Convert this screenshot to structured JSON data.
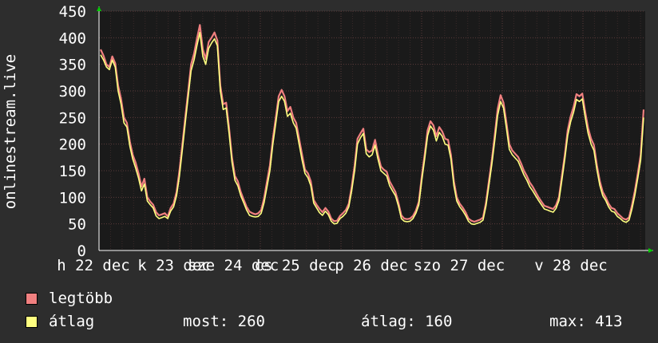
{
  "chart_data": {
    "type": "line",
    "ylabel": "onlinestream.live",
    "ylim": [
      0,
      450
    ],
    "yticks": [
      0,
      50,
      100,
      150,
      200,
      250,
      300,
      350,
      400,
      450
    ],
    "x_tick_labels": [
      "h 22 dec",
      "k 23 dec",
      "sze 24 dec",
      "cs 25 dec",
      "p 26 dec",
      "szo 27 dec",
      "v 28 dec"
    ],
    "grid": true,
    "colors": {
      "background": "#2d2d2d",
      "plot_bg": "#1a1a1a",
      "grid": "#5a3a3a",
      "max_series": "#f08080",
      "avg_series": "#ffff80",
      "axis_arrow": "#00cc00"
    },
    "series": [
      {
        "name": "legtöbb",
        "values": [
          378,
          366,
          350,
          345,
          365,
          352,
          310,
          285,
          250,
          240,
          205,
          180,
          165,
          145,
          120,
          135,
          100,
          92,
          86,
          72,
          66,
          68,
          70,
          64,
          80,
          88,
          110,
          150,
          200,
          250,
          300,
          350,
          370,
          398,
          424,
          378,
          360,
          392,
          400,
          410,
          395,
          310,
          275,
          278,
          230,
          175,
          140,
          130,
          110,
          96,
          82,
          73,
          70,
          68,
          70,
          76,
          98,
          130,
          160,
          210,
          250,
          290,
          302,
          290,
          262,
          270,
          250,
          240,
          210,
          180,
          152,
          145,
          130,
          95,
          86,
          78,
          72,
          80,
          73,
          60,
          55,
          56,
          65,
          70,
          76,
          88,
          120,
          160,
          210,
          220,
          229,
          190,
          185,
          188,
          208,
          180,
          158,
          152,
          148,
          130,
          120,
          110,
          90,
          66,
          60,
          59,
          60,
          65,
          75,
          92,
          140,
          180,
          226,
          243,
          235,
          215,
          232,
          224,
          210,
          208,
          180,
          130,
          100,
          88,
          81,
          72,
          60,
          56,
          54,
          56,
          58,
          62,
          90,
          130,
          170,
          216,
          266,
          292,
          278,
          240,
          200,
          188,
          182,
          176,
          164,
          150,
          140,
          128,
          120,
          110,
          100,
          92,
          84,
          82,
          80,
          78,
          85,
          100,
          140,
          180,
          226,
          252,
          270,
          294,
          290,
          295,
          260,
          230,
          210,
          198,
          160,
          130,
          110,
          100,
          88,
          80,
          78,
          70,
          65,
          60,
          58,
          62,
          85,
          112,
          145,
          180,
          265
        ]
      },
      {
        "name": "átlag",
        "values": [
          368,
          358,
          345,
          340,
          358,
          345,
          300,
          275,
          240,
          232,
          196,
          172,
          155,
          136,
          112,
          125,
          93,
          86,
          80,
          65,
          60,
          62,
          64,
          60,
          74,
          82,
          103,
          140,
          190,
          240,
          290,
          338,
          358,
          385,
          410,
          365,
          350,
          380,
          390,
          398,
          385,
          300,
          265,
          268,
          220,
          166,
          132,
          122,
          103,
          90,
          76,
          66,
          64,
          63,
          64,
          70,
          90,
          120,
          150,
          200,
          240,
          280,
          290,
          280,
          252,
          258,
          240,
          230,
          200,
          170,
          145,
          137,
          122,
          89,
          80,
          71,
          66,
          74,
          67,
          55,
          50,
          51,
          60,
          64,
          70,
          82,
          112,
          150,
          200,
          212,
          220,
          182,
          176,
          180,
          198,
          172,
          150,
          145,
          140,
          122,
          112,
          103,
          84,
          60,
          55,
          54,
          55,
          60,
          70,
          86,
          132,
          172,
          216,
          234,
          226,
          206,
          222,
          215,
          200,
          198,
          172,
          122,
          93,
          82,
          75,
          66,
          55,
          50,
          49,
          51,
          53,
          57,
          84,
          122,
          162,
          206,
          254,
          280,
          268,
          230,
          190,
          180,
          174,
          168,
          155,
          142,
          132,
          120,
          112,
          103,
          94,
          86,
          78,
          76,
          74,
          72,
          79,
          94,
          132,
          172,
          216,
          242,
          260,
          284,
          280,
          285,
          250,
          220,
          200,
          188,
          152,
          122,
          103,
          94,
          82,
          74,
          72,
          64,
          60,
          55,
          53,
          57,
          78,
          104,
          136,
          170,
          250
        ]
      }
    ]
  },
  "legend": [
    {
      "label": "legtöbb",
      "color": "#f08080"
    },
    {
      "label": "átlag",
      "color": "#ffff80"
    }
  ],
  "stats": {
    "now": "most: 260",
    "avg": "átlag: 160",
    "max": "max: 413"
  }
}
